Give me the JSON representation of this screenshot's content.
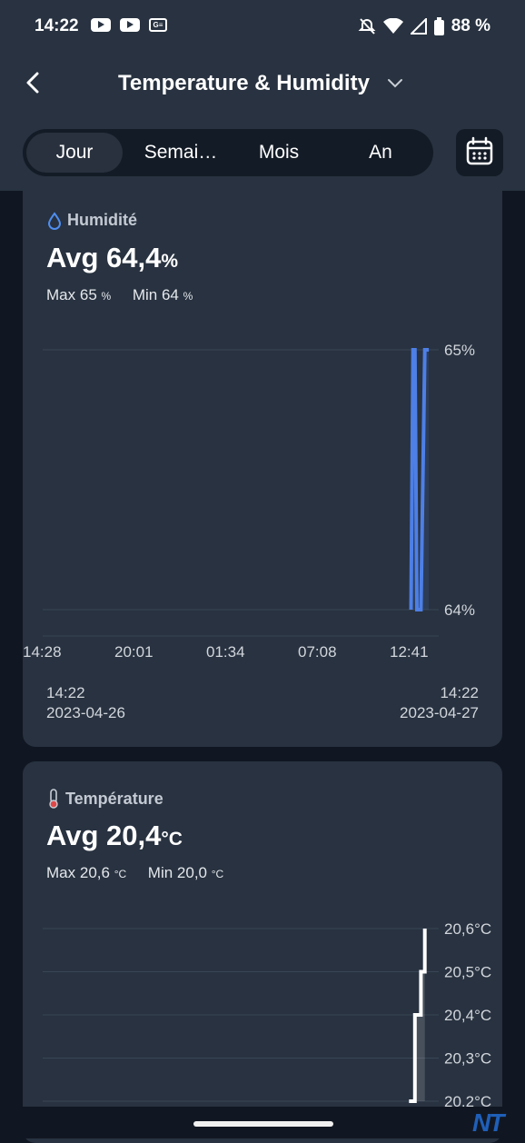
{
  "status": {
    "time": "14:22",
    "battery": "88 %"
  },
  "header": {
    "title": "Temperature & Humidity"
  },
  "tabs": [
    {
      "label": "Jour",
      "active": true
    },
    {
      "label": "Semai…",
      "active": false
    },
    {
      "label": "Mois",
      "active": false
    },
    {
      "label": "An",
      "active": false
    }
  ],
  "humidity": {
    "title": "Humidité",
    "avg_label": "Avg",
    "avg": "64,4",
    "unit": "%",
    "max_label": "Max",
    "max": "65",
    "min_label": "Min",
    "min": "64",
    "start_time": "14:22",
    "start_date": "2023-04-26",
    "end_time": "14:22",
    "end_date": "2023-04-27"
  },
  "temperature": {
    "title": "Température",
    "avg_label": "Avg",
    "avg": "20,4",
    "unit": "°C",
    "max_label": "Max",
    "max": "20,6",
    "min_label": "Min",
    "min": "20,0"
  },
  "chart_data": [
    {
      "type": "line",
      "title": "Humidité",
      "y_ticks": [
        "65%",
        "64%"
      ],
      "ylim": [
        64,
        65
      ],
      "x_ticks": [
        "14:28",
        "20:01",
        "01:34",
        "07:08",
        "12:41"
      ],
      "x": [
        0.93,
        0.935,
        0.94,
        0.945,
        0.955,
        0.965,
        0.975
      ],
      "values": [
        64,
        65,
        65,
        64,
        64,
        65,
        65
      ],
      "color": "#4d7fe6"
    },
    {
      "type": "line",
      "title": "Température",
      "y_ticks": [
        "20,6°C",
        "20,5°C",
        "20,4°C",
        "20,3°C",
        "20,2°C"
      ],
      "ylim": [
        20.2,
        20.6
      ],
      "x": [
        0.925,
        0.94,
        0.94,
        0.955,
        0.955,
        0.965,
        0.965
      ],
      "values": [
        20.2,
        20.2,
        20.4,
        20.4,
        20.5,
        20.5,
        20.6
      ],
      "color": "#ffffff"
    }
  ]
}
